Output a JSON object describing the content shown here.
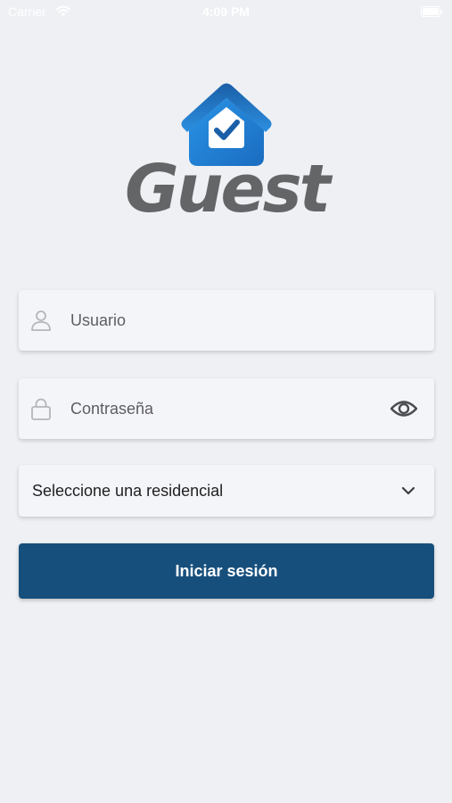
{
  "status_bar": {
    "carrier": "Carrier",
    "time": "4:09 PM",
    "wifi_icon": "wifi-icon",
    "battery_icon": "battery-icon"
  },
  "logo": {
    "wordmark": "Guest",
    "mark_icon": "house-check-icon",
    "colors": {
      "mark_blue": "#2a8fe0",
      "mark_dark_blue": "#1565b0",
      "wordmark_gray": "#646567"
    }
  },
  "form": {
    "username": {
      "placeholder": "Usuario",
      "value": "",
      "icon": "user-icon"
    },
    "password": {
      "placeholder": "Contraseña",
      "value": "",
      "icon": "lock-icon",
      "toggle_icon": "eye-icon"
    },
    "residence_select": {
      "selected_label": "Seleccione una residencial",
      "icon": "chevron-down-icon"
    },
    "submit_label": "Iniciar sesión"
  },
  "colors": {
    "background": "#eef0f4",
    "field_background": "#f4f5f8",
    "button": "#174f7c",
    "button_text": "#ffffff"
  }
}
